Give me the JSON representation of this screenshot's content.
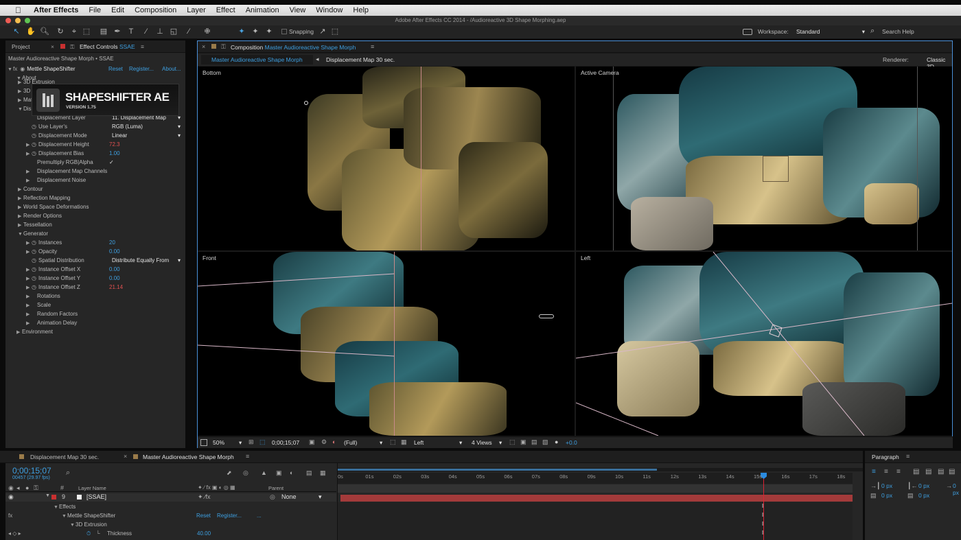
{
  "menubar": {
    "app": "After Effects",
    "items": [
      "File",
      "Edit",
      "Composition",
      "Layer",
      "Effect",
      "Animation",
      "View",
      "Window",
      "Help"
    ]
  },
  "titlebar": {
    "title": "Adobe After Effects CC 2014 - /Audioreactive 3D Shape Morphing.aep"
  },
  "toolbar": {
    "snapping": "Snapping",
    "workspace_label": "Workspace:",
    "workspace_value": "Standard",
    "search_placeholder": "Search Help"
  },
  "left_panel": {
    "tab_project": "Project",
    "tab_effect_controls": "Effect Controls",
    "tab_effect_controls_target": "SSAE",
    "header": "Master Audioreactive Shape Morph • SSAE",
    "effect_name": "Mettle ShapeShifter",
    "reset": "Reset",
    "register": "Register...",
    "about_link": "About...",
    "about": "About",
    "logo_title": "SHAPESHIFTER AE",
    "logo_version": "VERSION 1.75",
    "rows": [
      {
        "label": "3D Extrusion"
      },
      {
        "label": "3D Transform"
      },
      {
        "label": "Material Properties"
      },
      {
        "label": "Displacement Mapping"
      },
      {
        "label": "Displacement Layer",
        "value": "11. Displacement Map"
      },
      {
        "label": "Use Layer's",
        "value": "RGB (Luma)"
      },
      {
        "label": "Displacement Mode",
        "value": "Linear"
      },
      {
        "label": "Displacement Height",
        "value": "72.3"
      },
      {
        "label": "Displacement Bias",
        "value": "1.00"
      },
      {
        "label": "Premultiply RGB|Alpha",
        "value": "✓"
      },
      {
        "label": "Displacement Map Channels"
      },
      {
        "label": "Displacement Noise"
      },
      {
        "label": "Contour"
      },
      {
        "label": "Reflection Mapping"
      },
      {
        "label": "World Space Deformations"
      },
      {
        "label": "Render Options"
      },
      {
        "label": "Tessellation"
      },
      {
        "label": "Generator"
      },
      {
        "label": "Instances",
        "value": "20"
      },
      {
        "label": "Opacity",
        "value": "0.00"
      },
      {
        "label": "Spatial Distribution",
        "value": "Distribute Equally From"
      },
      {
        "label": "Instance Offset X",
        "value": "0.00"
      },
      {
        "label": "Instance Offset Y",
        "value": "0.00"
      },
      {
        "label": "Instance Offset Z",
        "value": "21.14"
      },
      {
        "label": "Rotations"
      },
      {
        "label": "Scale"
      },
      {
        "label": "Random Factors"
      },
      {
        "label": "Animation Delay"
      },
      {
        "label": "Environment"
      }
    ]
  },
  "comp_panel": {
    "tab_label": "Composition",
    "tab_name": "Master Audioreactive Shape Morph",
    "crumb_active": "Master Audioreactive Shape Morph",
    "crumb_next": "Displacement Map 30 sec.",
    "renderer_label": "Renderer:",
    "renderer_value": "Classic 3D",
    "viewports": [
      "Bottom",
      "Active Camera",
      "Front",
      "Left"
    ],
    "zoom": "50%",
    "timecode": "0;00;15;07",
    "resolution": "(Full)",
    "view": "Left",
    "views": "4 Views",
    "exposure": "+0.0"
  },
  "timeline": {
    "tab1": "Displacement Map 30 sec.",
    "tab2": "Master Audioreactive Shape Morph",
    "timecode": "0;00;15;07",
    "frame_info": "00457 (29.97 fps)",
    "col_layer_name": "Layer Name",
    "col_parent": "Parent",
    "layer_num": "9",
    "layer_name": "[SSAE]",
    "parent_value": "None",
    "effects": "Effects",
    "effect": "Mettle ShapeShifter",
    "reset": "Reset",
    "register": "Register...",
    "ellipsis": "...",
    "sub_group": "3D Extrusion",
    "thickness_label": "Thickness",
    "thickness_value": "40.00",
    "ruler": [
      "0s",
      "01s",
      "02s",
      "03s",
      "04s",
      "05s",
      "06s",
      "07s",
      "08s",
      "09s",
      "10s",
      "11s",
      "12s",
      "13s",
      "14s",
      "15s",
      "16s",
      "17s",
      "18s"
    ],
    "playhead_seconds": 15.25
  },
  "paragraph": {
    "title": "Paragraph",
    "px1": "0 px",
    "px2": "0 px",
    "px3": "0 px",
    "px4": "0 px",
    "px5": "0 px"
  },
  "colors": {
    "accent": "#3e9fe0",
    "red_value": "#e05050",
    "layer_bar": "#a33a3a",
    "playhead": "#2a8be0"
  }
}
